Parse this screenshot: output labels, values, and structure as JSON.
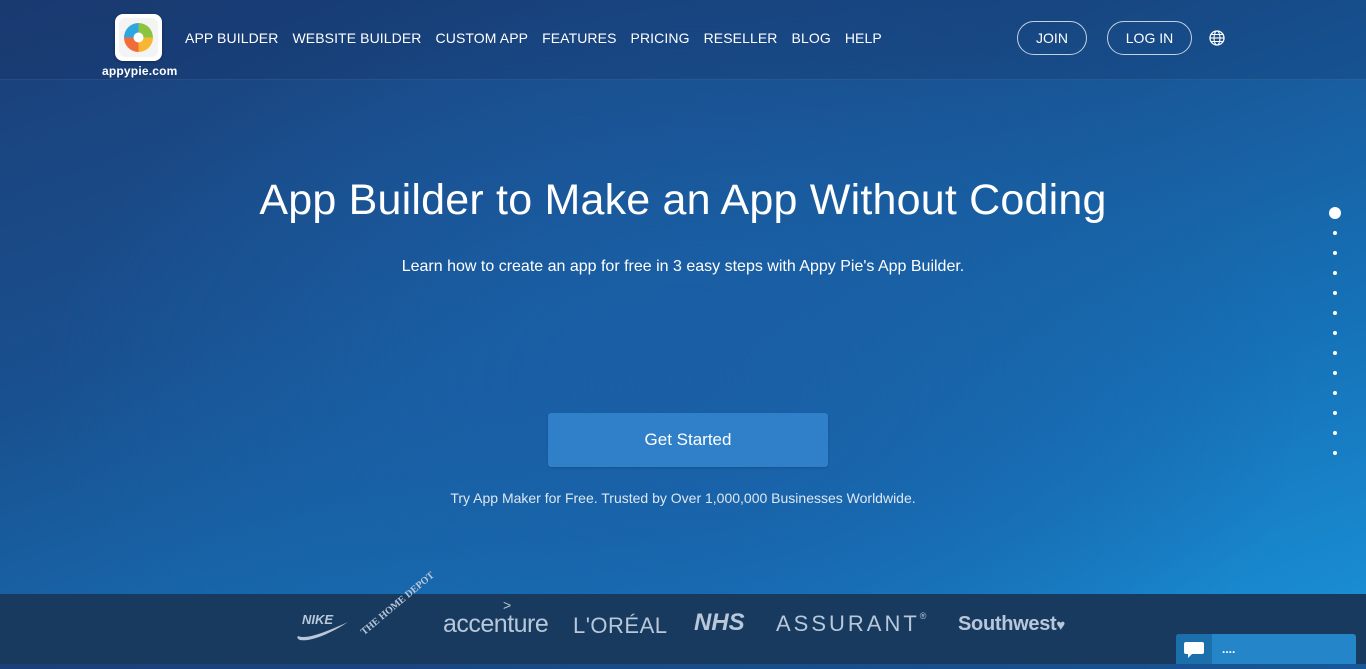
{
  "header": {
    "brand": "appypie.com",
    "nav": [
      "APP BUILDER",
      "WEBSITE BUILDER",
      "CUSTOM APP",
      "FEATURES",
      "PRICING",
      "RESELLER",
      "BLOG",
      "HELP"
    ],
    "join_label": "JOIN",
    "login_label": "LOG IN",
    "language_icon": "globe-icon"
  },
  "hero": {
    "title": "App Builder to Make an App Without Coding",
    "subtitle": "Learn how to create an app for free in 3 easy steps with Appy Pie's App Builder.",
    "cta_label": "Get Started",
    "trusted_text": "Try App Maker for Free. Trusted by Over 1,000,000 Businesses Worldwide."
  },
  "pager": {
    "total": 13,
    "active_index": 0
  },
  "clients": {
    "logos": [
      "NIKE",
      "THE HOME DEPOT",
      "accenture",
      "L'ORÉAL",
      "NHS",
      "ASSURANT",
      "Southwest"
    ],
    "accenture_mark": ">",
    "assurant_mark": "®",
    "southwest_mark": "♥"
  },
  "chat": {
    "label": "....",
    "icon": "chat-bubble-icon"
  },
  "colors": {
    "cta_bg": "#2f80c9",
    "footer_bg": "#173a5e",
    "chat_bg": "#2486c8"
  }
}
